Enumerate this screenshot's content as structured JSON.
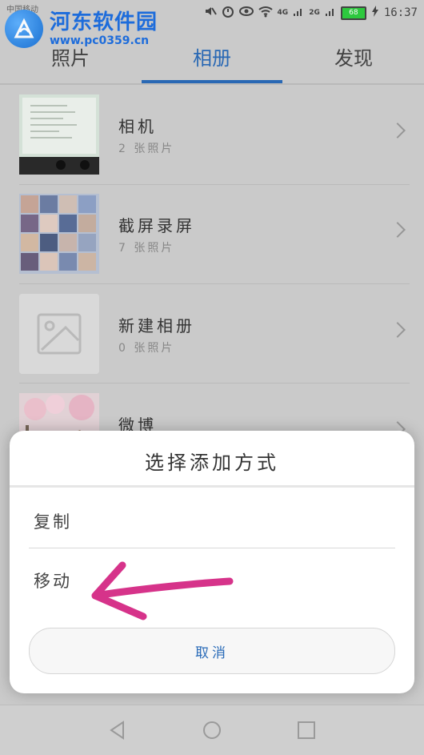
{
  "status_bar": {
    "carrier": "中国移动",
    "signal_4g": "4G",
    "signal_2g": "2G",
    "battery": "68",
    "time": "16:37"
  },
  "watermark": {
    "title": "河东软件园",
    "url": "www.pc0359.cn"
  },
  "tabs": [
    {
      "label": "照片",
      "active": false
    },
    {
      "label": "相册",
      "active": true
    },
    {
      "label": "发现",
      "active": false
    }
  ],
  "albums": [
    {
      "name": "相机",
      "count": "2 张照片"
    },
    {
      "name": "截屏录屏",
      "count": "7 张照片"
    },
    {
      "name": "新建相册",
      "count": "0 张照片"
    },
    {
      "name": "微博",
      "count": ""
    }
  ],
  "dialog": {
    "title": "选择添加方式",
    "options": [
      "复制",
      "移动"
    ],
    "cancel": "取消"
  },
  "colors": {
    "accent": "#2a6bb8",
    "annotation_arrow": "#d6338a"
  }
}
